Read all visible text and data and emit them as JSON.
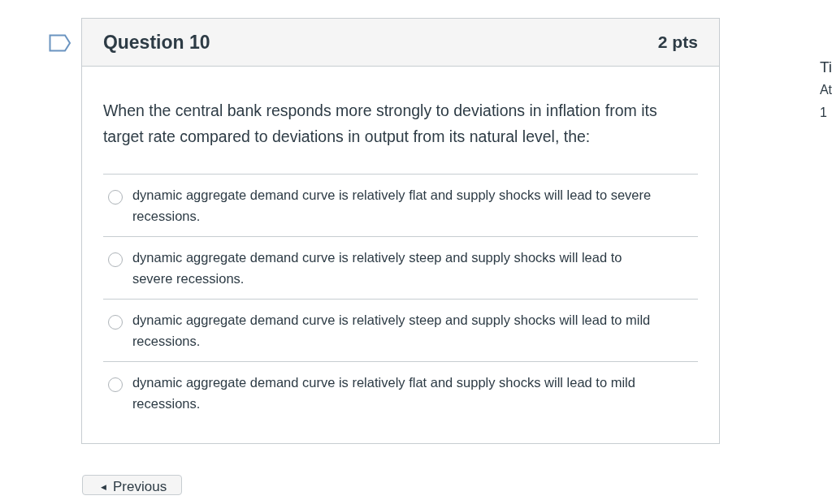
{
  "question": {
    "title": "Question 10",
    "points": "2 pts",
    "flagged": false,
    "text": "When the central bank responds more strongly to deviations in inflation from its target rate compared to deviations in output from its natural level, the:",
    "answers": [
      {
        "label": "dynamic aggregate demand curve is relatively flat and supply shocks will lead to severe recessions.",
        "selected": false
      },
      {
        "label": "dynamic aggregate demand curve is relatively steep and supply shocks will lead to severe recessions.",
        "selected": false
      },
      {
        "label": "dynamic aggregate demand curve is relatively steep and supply shocks will lead to mild recessions.",
        "selected": false
      },
      {
        "label": "dynamic aggregate demand curve is relatively flat and supply shocks will lead to mild recessions.",
        "selected": false
      }
    ]
  },
  "side_panel": [
    "Ti",
    "At",
    "1"
  ],
  "nav": {
    "previous_arrow": "◀",
    "previous": "Previous"
  }
}
